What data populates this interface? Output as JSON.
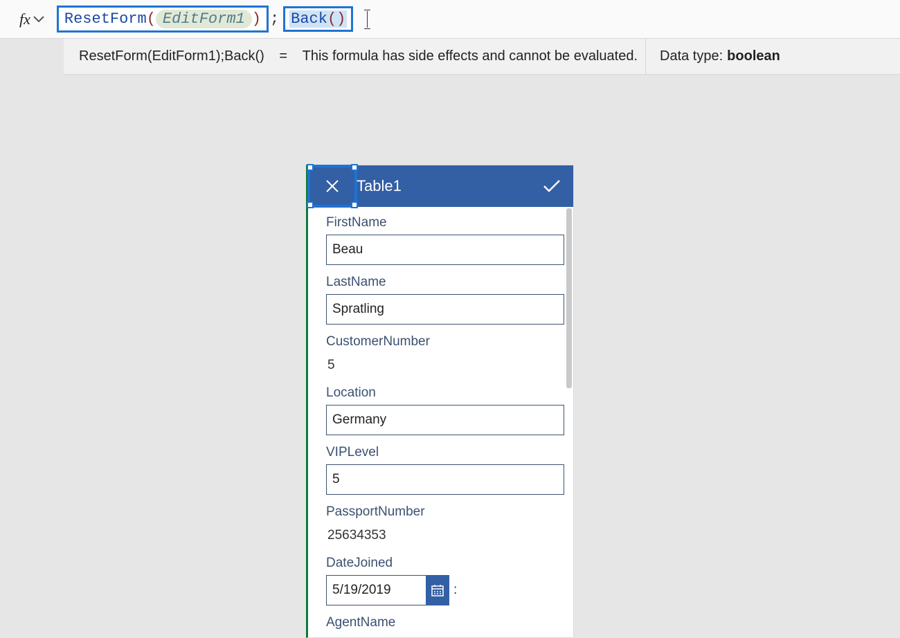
{
  "formulaBar": {
    "fxLabel": "fx",
    "part1_fn": "ResetForm",
    "part1_open": "(",
    "part1_arg": "EditForm1",
    "part1_close": ")",
    "sep": ";",
    "part2_fn": "Back",
    "part2_parens": "()"
  },
  "resultBar": {
    "expr": "ResetForm(EditForm1);Back()",
    "eq": "=",
    "msg": "This formula has side effects and cannot be evaluated.",
    "dtLabel": "Data type:",
    "dtValue": "boolean"
  },
  "header": {
    "title": "Table1"
  },
  "form": {
    "firstName": {
      "label": "FirstName",
      "value": "Beau"
    },
    "lastName": {
      "label": "LastName",
      "value": "Spratling"
    },
    "customerNumber": {
      "label": "CustomerNumber",
      "value": "5"
    },
    "location": {
      "label": "Location",
      "value": "Germany"
    },
    "vipLevel": {
      "label": "VIPLevel",
      "value": "5"
    },
    "passportNumber": {
      "label": "PassportNumber",
      "value": "25634353"
    },
    "dateJoined": {
      "label": "DateJoined",
      "value": "5/19/2019",
      "sep": ":"
    },
    "agentName": {
      "label": "AgentName"
    }
  }
}
